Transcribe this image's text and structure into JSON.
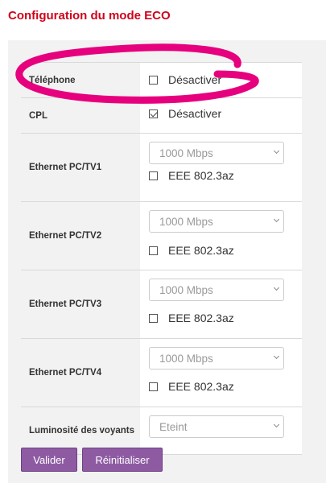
{
  "page_title": "Configuration du mode ECO",
  "rows": {
    "telephone": {
      "label": "Téléphone",
      "checkbox_label": "Désactiver",
      "checked": false
    },
    "cpl": {
      "label": "CPL",
      "checkbox_label": "Désactiver",
      "checked": true
    },
    "eth1": {
      "label": "Ethernet PC/TV1",
      "speed": "1000 Mbps",
      "eee_label": "EEE 802.3az",
      "eee_checked": false
    },
    "eth2": {
      "label": "Ethernet PC/TV2",
      "speed": "1000 Mbps",
      "eee_label": "EEE 802.3az",
      "eee_checked": false
    },
    "eth3": {
      "label": "Ethernet PC/TV3",
      "speed": "1000 Mbps",
      "eee_label": "EEE 802.3az",
      "eee_checked": false
    },
    "eth4": {
      "label": "Ethernet PC/TV4",
      "speed": "1000 Mbps",
      "eee_label": "EEE 802.3az",
      "eee_checked": false
    },
    "luminosite": {
      "label": "Luminosité des voyants",
      "value": "Eteint"
    }
  },
  "buttons": {
    "valider": "Valider",
    "reinitialiser": "Réinitialiser"
  },
  "colors": {
    "title": "#d0021b",
    "button": "#8e5ba3",
    "highlight": "#e6007e"
  }
}
